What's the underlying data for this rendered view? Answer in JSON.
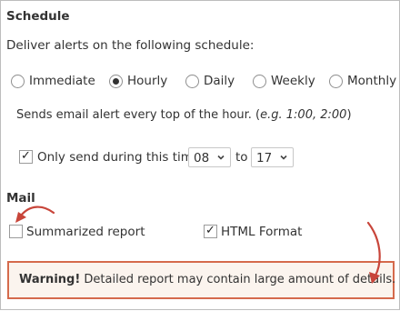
{
  "schedule": {
    "title": "Schedule",
    "description": "Deliver alerts on the following schedule:",
    "options": [
      {
        "label": "Immediate",
        "selected": false
      },
      {
        "label": "Hourly",
        "selected": true
      },
      {
        "label": "Daily",
        "selected": false
      },
      {
        "label": "Weekly",
        "selected": false
      },
      {
        "label": "Monthly",
        "selected": false
      }
    ],
    "hint_prefix": "Sends email alert every top of the hour. (",
    "hint_example": "e.g. 1:00, 2:00",
    "hint_suffix": ")",
    "time_restriction": {
      "checked": true,
      "label": "Only send during this time:",
      "from_value": "08",
      "to_label": "to",
      "to_value": "17"
    }
  },
  "mail": {
    "title": "Mail",
    "summarized_report": {
      "label": "Summarized report",
      "checked": false
    },
    "html_format": {
      "label": "HTML Format",
      "checked": true
    }
  },
  "warning": {
    "strong": "Warning!",
    "text": " Detailed report may contain large amount of details."
  },
  "colors": {
    "warning_border": "#d56a4c",
    "warning_background": "#fbf4ee",
    "annotation_arrow": "#c8453a"
  },
  "icons": {
    "checkmark": "✓",
    "chevron": "chevron-down-icon"
  }
}
